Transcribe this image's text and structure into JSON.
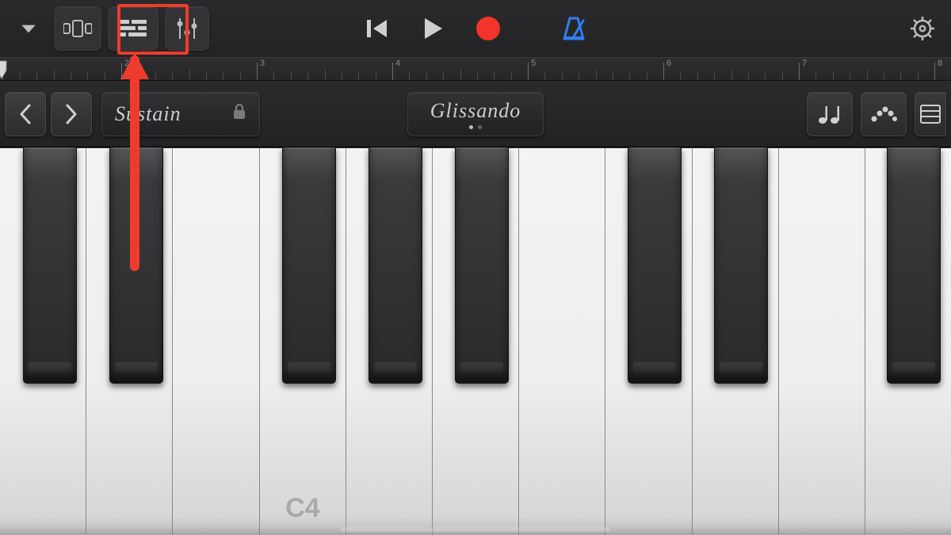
{
  "toolbar": {
    "browser_icon": "chevron-down",
    "view_icon": "song-sections",
    "tracks_icon": "tracks-view",
    "fx_icon": "track-controls",
    "rewind_icon": "go-to-beginning",
    "play_icon": "play",
    "record_icon": "record",
    "record_color": "#f2342a",
    "metronome_icon": "metronome",
    "metronome_color": "#2f7ef0",
    "settings_icon": "settings-gear"
  },
  "ruler": {
    "start": 1,
    "end": 8,
    "subdivisions": 4,
    "playhead_bar": 1
  },
  "controls": {
    "prev_icon": "chevron-left",
    "next_icon": "chevron-right",
    "sustain_label": "Sustain",
    "sustain_lock_icon": "lock",
    "glissando_label": "Glissando",
    "glissando_page": 0,
    "glissando_pages": 2,
    "arpeggiator_icon": "notes",
    "chord_strips_icon": "chord-strips",
    "keyboard_layout_icon": "keyboard-layout"
  },
  "piano": {
    "octave_label": "C4",
    "white_key_count": 11,
    "first_white_note": "G3",
    "black_key_positions_pct": [
      5.26,
      14.35,
      32.5,
      41.6,
      50.7,
      68.85,
      77.95,
      96.1
    ]
  },
  "annotation": {
    "highlight_target": "tracks-view-button",
    "arrow_color": "#ef3b2e"
  }
}
